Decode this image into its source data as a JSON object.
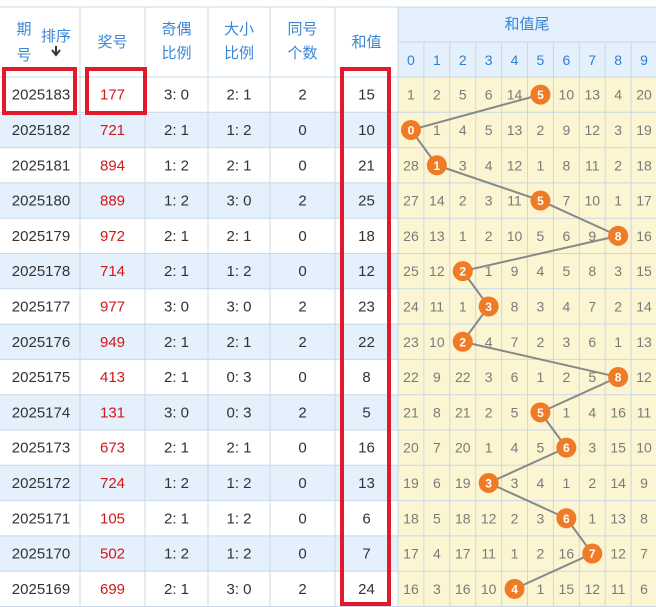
{
  "table": {
    "headers": {
      "period_top": "期",
      "period_bottom": "号",
      "sort": "排序",
      "number": "奖号",
      "odd_even_1": "奇偶",
      "odd_even_2": "比例",
      "big_small_1": "大小",
      "big_small_2": "比例",
      "same_1": "同号",
      "same_2": "个数",
      "sum": "和值",
      "sum_tail": "和值尾"
    },
    "tail_digits": [
      "0",
      "1",
      "2",
      "3",
      "4",
      "5",
      "6",
      "7",
      "8",
      "9"
    ],
    "rows": [
      {
        "period": "2025183",
        "number": "177",
        "odd_even": "3: 0",
        "big_small": "2: 1",
        "same": "2",
        "sum": "15",
        "tail": "5",
        "cells": [
          "1",
          "2",
          "5",
          "6",
          "14",
          "5",
          "10",
          "13",
          "4",
          "20"
        ]
      },
      {
        "period": "2025182",
        "number": "721",
        "odd_even": "2: 1",
        "big_small": "1: 2",
        "same": "0",
        "sum": "10",
        "tail": "0",
        "cells": [
          "0",
          "1",
          "4",
          "5",
          "13",
          "2",
          "9",
          "12",
          "3",
          "19"
        ]
      },
      {
        "period": "2025181",
        "number": "894",
        "odd_even": "1: 2",
        "big_small": "2: 1",
        "same": "0",
        "sum": "21",
        "tail": "1",
        "cells": [
          "28",
          "1",
          "3",
          "4",
          "12",
          "1",
          "8",
          "11",
          "2",
          "18"
        ]
      },
      {
        "period": "2025180",
        "number": "889",
        "odd_even": "1: 2",
        "big_small": "3: 0",
        "same": "2",
        "sum": "25",
        "tail": "5",
        "cells": [
          "27",
          "14",
          "2",
          "3",
          "11",
          "5",
          "7",
          "10",
          "1",
          "17"
        ]
      },
      {
        "period": "2025179",
        "number": "972",
        "odd_even": "2: 1",
        "big_small": "2: 1",
        "same": "0",
        "sum": "18",
        "tail": "8",
        "cells": [
          "26",
          "13",
          "1",
          "2",
          "10",
          "5",
          "6",
          "9",
          "8",
          "16"
        ]
      },
      {
        "period": "2025178",
        "number": "714",
        "odd_even": "2: 1",
        "big_small": "1: 2",
        "same": "0",
        "sum": "12",
        "tail": "2",
        "cells": [
          "25",
          "12",
          "2",
          "1",
          "9",
          "4",
          "5",
          "8",
          "3",
          "15"
        ]
      },
      {
        "period": "2025177",
        "number": "977",
        "odd_even": "3: 0",
        "big_small": "3: 0",
        "same": "2",
        "sum": "23",
        "tail": "3",
        "cells": [
          "24",
          "11",
          "1",
          "3",
          "8",
          "3",
          "4",
          "7",
          "2",
          "14"
        ]
      },
      {
        "period": "2025176",
        "number": "949",
        "odd_even": "2: 1",
        "big_small": "2: 1",
        "same": "2",
        "sum": "22",
        "tail": "2",
        "cells": [
          "23",
          "10",
          "2",
          "4",
          "7",
          "2",
          "3",
          "6",
          "1",
          "13"
        ]
      },
      {
        "period": "2025175",
        "number": "413",
        "odd_even": "2: 1",
        "big_small": "0: 3",
        "same": "0",
        "sum": "8",
        "tail": "8",
        "cells": [
          "22",
          "9",
          "22",
          "3",
          "6",
          "1",
          "2",
          "5",
          "8",
          "12"
        ]
      },
      {
        "period": "2025174",
        "number": "131",
        "odd_even": "3: 0",
        "big_small": "0: 3",
        "same": "2",
        "sum": "5",
        "tail": "5",
        "cells": [
          "21",
          "8",
          "21",
          "2",
          "5",
          "5",
          "1",
          "4",
          "16",
          "11"
        ]
      },
      {
        "period": "2025173",
        "number": "673",
        "odd_even": "2: 1",
        "big_small": "2: 1",
        "same": "0",
        "sum": "16",
        "tail": "6",
        "cells": [
          "20",
          "7",
          "20",
          "1",
          "4",
          "5",
          "6",
          "3",
          "15",
          "10"
        ]
      },
      {
        "period": "2025172",
        "number": "724",
        "odd_even": "1: 2",
        "big_small": "1: 2",
        "same": "0",
        "sum": "13",
        "tail": "3",
        "cells": [
          "19",
          "6",
          "19",
          "3",
          "3",
          "4",
          "1",
          "2",
          "14",
          "9"
        ]
      },
      {
        "period": "2025171",
        "number": "105",
        "odd_even": "2: 1",
        "big_small": "1: 2",
        "same": "0",
        "sum": "6",
        "tail": "6",
        "cells": [
          "18",
          "5",
          "18",
          "12",
          "2",
          "3",
          "6",
          "1",
          "13",
          "8"
        ]
      },
      {
        "period": "2025170",
        "number": "502",
        "odd_even": "1: 2",
        "big_small": "1: 2",
        "same": "0",
        "sum": "7",
        "tail": "7",
        "cells": [
          "17",
          "4",
          "17",
          "11",
          "1",
          "2",
          "16",
          "7",
          "12",
          "7"
        ]
      },
      {
        "period": "2025169",
        "number": "699",
        "odd_even": "2: 1",
        "big_small": "3: 0",
        "same": "2",
        "sum": "24",
        "tail": "4",
        "cells": [
          "16",
          "3",
          "16",
          "10",
          "4",
          "1",
          "15",
          "12",
          "11",
          "6"
        ]
      }
    ]
  },
  "colors": {
    "header_text": "#3a86d6",
    "red_number": "#d01818",
    "ball": "#f07b27",
    "line": "#888888",
    "highlight_box": "#e0192c",
    "row_alt": "#e4f0fb",
    "tail_bg": "#fcf5d2",
    "border": "#c8d8e8"
  },
  "chart_data": {
    "type": "table",
    "categories": [
      "2025183",
      "2025182",
      "2025181",
      "2025180",
      "2025179",
      "2025178",
      "2025177",
      "2025176",
      "2025175",
      "2025174",
      "2025173",
      "2025172",
      "2025171",
      "2025170",
      "2025169"
    ],
    "series": [
      {
        "name": "和值",
        "values": [
          15,
          10,
          21,
          25,
          18,
          12,
          23,
          22,
          8,
          5,
          16,
          13,
          6,
          7,
          24
        ]
      },
      {
        "name": "和值尾",
        "values": [
          5,
          0,
          1,
          5,
          8,
          2,
          3,
          2,
          8,
          5,
          6,
          3,
          6,
          7,
          4
        ]
      }
    ],
    "xlabel": "",
    "ylabel": ""
  }
}
